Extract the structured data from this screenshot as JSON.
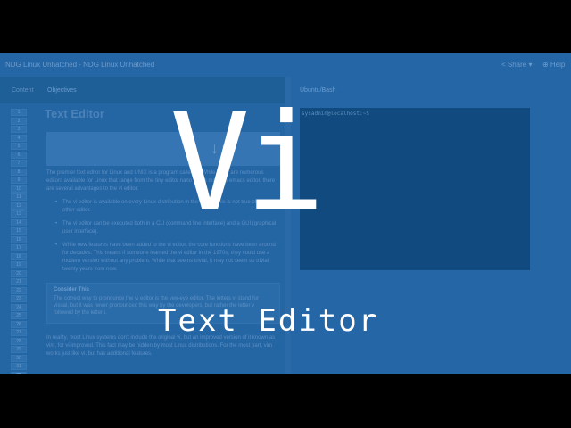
{
  "window": {
    "title": "NDG Linux Unhatched - NDG Linux Unhatched",
    "share_label": "< Share ▾",
    "help_label": "⊕ Help"
  },
  "tabs": [
    {
      "label": "Content"
    },
    {
      "label": "Objectives"
    }
  ],
  "line_numbers": [
    "1",
    "2",
    "3",
    "4",
    "5",
    "6",
    "7",
    "8",
    "9",
    "10",
    "11",
    "12",
    "13",
    "14",
    "15",
    "16",
    "17",
    "18",
    "19",
    "20",
    "21",
    "22",
    "23",
    "24",
    "25",
    "26",
    "27",
    "28",
    "29",
    "30",
    "31",
    "32",
    "33",
    "34"
  ],
  "selected_line": "32",
  "lesson": {
    "heading": "Text Editor",
    "arrows": "↓↑",
    "intro": "The premier text editor for Linux and UNIX is a program called vi. While there are numerous editors available for Linux that range from the tiny editor nano to the massive emacs editor, there are several advantages to the vi editor:",
    "bullets": [
      "The vi editor is available on every Linux distribution in the world. This is not true of any other editor.",
      "The vi editor can be executed both in a CLI (command line interface) and a GUI (graphical user interface).",
      "While new features have been added to the vi editor, the core functions have been around for decades. This means if someone learned the vi editor in the 1970s, they could use a modern version without any problem. While that seems trivial, it may not seem so trivial twenty years from now."
    ],
    "consider_title": "Consider This",
    "consider_body": "The correct way to pronounce the vi editor is the vee-eye editor. The letters vi stand for visual, but it was never pronounced this way by the developers, but rather the letter v followed by the letter i.",
    "closing": "In reality, most Linux systems don't include the original vi, but an improved version of it known as vim, for vi improved. This fact may be hidden by most Linux distributions. For the most part, vim works just like vi, but has additional features."
  },
  "terminal": {
    "tab_label": "Ubuntu/Bash",
    "prompt": "sysadmin@localhost:~$"
  },
  "overlay": {
    "big_title": "Vi",
    "subtitle": "Text Editor"
  }
}
